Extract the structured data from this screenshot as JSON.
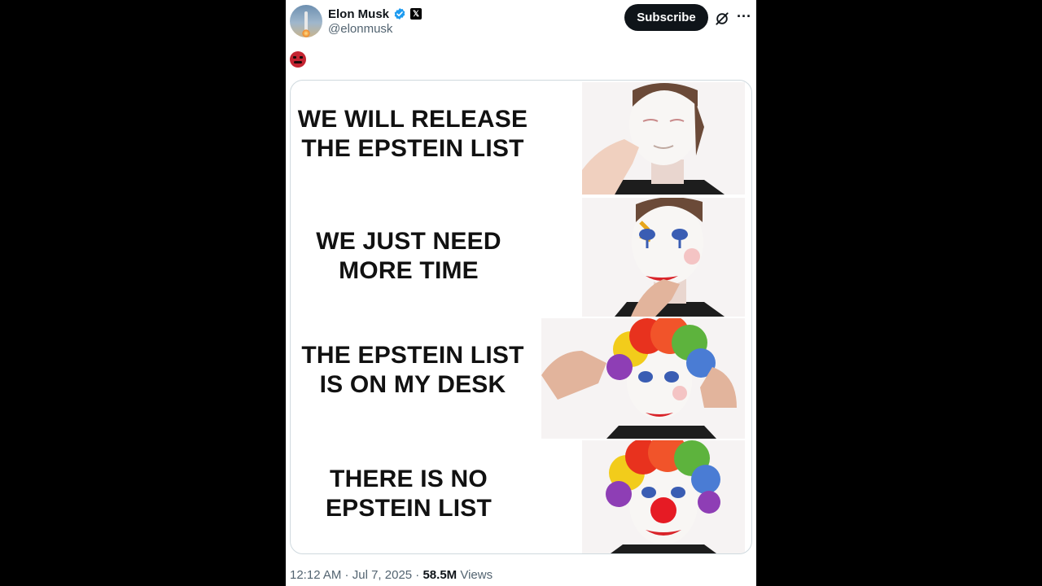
{
  "author": {
    "display_name": "Elon Musk",
    "handle": "@elonmusk",
    "x_badge": "𝕏"
  },
  "actions": {
    "subscribe_label": "Subscribe",
    "more_label": "···"
  },
  "post": {
    "emoji": "enraged-face-emoji",
    "meme_panels": [
      "WE WILL RELEASE THE EPSTEIN LIST",
      "WE JUST NEED MORE TIME",
      "THE EPSTEIN LIST IS ON MY DESK",
      "THERE IS NO EPSTEIN LIST"
    ]
  },
  "meta": {
    "time": "12:12 AM",
    "separator": " · ",
    "date": "Jul 7, 2025",
    "views_count": "58.5M",
    "views_label": " Views"
  },
  "colors": {
    "background": "#000000",
    "card": "#ffffff",
    "verified": "#1d9bf0",
    "secondary_text": "#536471",
    "primary_text": "#0f1419"
  }
}
